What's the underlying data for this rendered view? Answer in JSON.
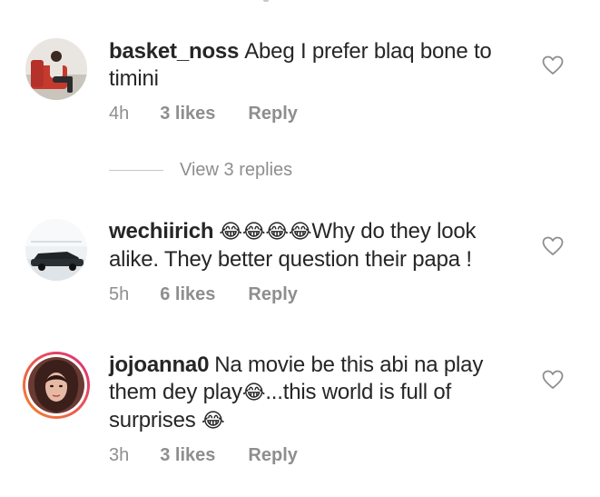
{
  "comments": [
    {
      "username": "basket_noss",
      "text_parts": [
        "Abeg I prefer blaq bone to timini"
      ],
      "time": "4h",
      "likes": "3 likes",
      "reply": "Reply",
      "avatar_icon": "user-photo-man-sitting-red"
    },
    {
      "username": "wechiirich",
      "emojis": "😂😂😂😂",
      "text": "Why do they look alike. They better question their papa !",
      "time": "5h",
      "likes": "6 likes",
      "reply": "Reply",
      "avatar_icon": "user-photo-car"
    },
    {
      "username": "jojoanna0",
      "text_1": "Na movie be this abi na play them dey play",
      "emoji_1": "😂",
      "text_2": "...this world is full of surprises ",
      "emoji_2": "😂",
      "time": "3h",
      "likes": "3 likes",
      "reply": "Reply",
      "avatar_icon": "user-photo-woman-story-ring"
    }
  ],
  "view_replies": "View 3 replies",
  "colors": {
    "text": "#262626",
    "meta": "#8e8e8e",
    "story_ring_start": "#f58529",
    "story_ring_end": "#dd2a7b"
  }
}
